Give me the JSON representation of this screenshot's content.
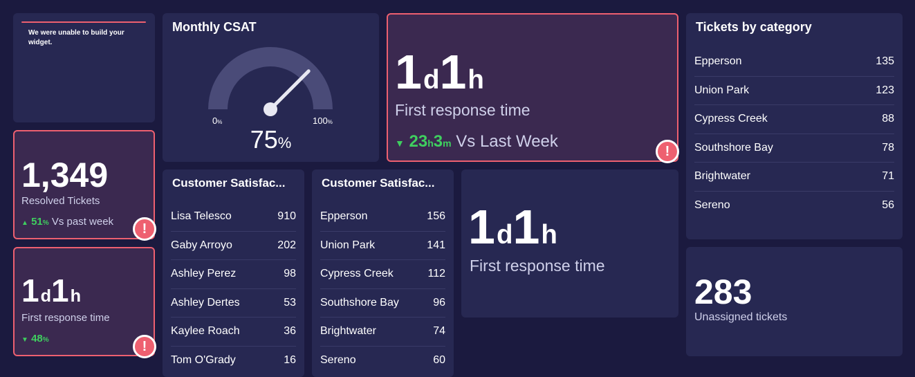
{
  "error_widget": {
    "message": "We were unable to build your widget."
  },
  "resolved": {
    "value": "1,349",
    "label": "Resolved Tickets",
    "trend_arrow": "▲",
    "trend_value": "51",
    "trend_unit": "%",
    "trend_text": "Vs past week"
  },
  "frt_small": {
    "value_d": "1",
    "unit_d": "d",
    "value_h": "1",
    "unit_h": "h",
    "label": "First response time",
    "trend_arrow": "▼",
    "trend_value": "48",
    "trend_unit": "%"
  },
  "csat": {
    "title": "Monthly CSAT",
    "min_label": "0",
    "min_unit": "%",
    "max_label": "100",
    "max_unit": "%",
    "value": "75",
    "value_unit": "%",
    "gauge_level": 0.75
  },
  "frt_large": {
    "value_d": "1",
    "unit_d": "d",
    "value_h": "1",
    "unit_h": "h",
    "label": "First response time",
    "trend_arrow": "▼",
    "trend_h": "23",
    "trend_h_unit": "h",
    "trend_m": "3",
    "trend_m_unit": "m",
    "trend_text": "Vs Last Week"
  },
  "frt_mid": {
    "value_d": "1",
    "unit_d": "d",
    "value_h": "1",
    "unit_h": "h",
    "label": "First response time"
  },
  "csat_agents": {
    "title": "Customer Satisfac...",
    "rows": [
      {
        "name": "Lisa Telesco",
        "value": "910"
      },
      {
        "name": "Gaby Arroyo",
        "value": "202"
      },
      {
        "name": "Ashley Perez",
        "value": "98"
      },
      {
        "name": "Ashley Dertes",
        "value": "53"
      },
      {
        "name": "Kaylee Roach",
        "value": "36"
      },
      {
        "name": "Tom O'Grady",
        "value": "16"
      }
    ]
  },
  "csat_locations": {
    "title": "Customer Satisfac...",
    "rows": [
      {
        "name": "Epperson",
        "value": "156"
      },
      {
        "name": "Union Park",
        "value": "141"
      },
      {
        "name": "Cypress Creek",
        "value": "112"
      },
      {
        "name": "Southshore Bay",
        "value": "96"
      },
      {
        "name": "Brightwater",
        "value": "74"
      },
      {
        "name": "Sereno",
        "value": "60"
      }
    ]
  },
  "tickets_by_category": {
    "title": "Tickets by category",
    "rows": [
      {
        "name": "Epperson",
        "value": "135"
      },
      {
        "name": "Union Park",
        "value": "123"
      },
      {
        "name": "Cypress Creek",
        "value": "88"
      },
      {
        "name": "Southshore Bay",
        "value": "78"
      },
      {
        "name": "Brightwater",
        "value": "71"
      },
      {
        "name": "Sereno",
        "value": "56"
      }
    ]
  },
  "unassigned": {
    "value": "283",
    "label": "Unassigned tickets"
  },
  "alert_icon": "!",
  "colors": {
    "background": "#1b1a3f",
    "card": "#272852",
    "alert_card": "#3b2950",
    "alert_border": "#ee6070",
    "positive": "#3fcf5f"
  }
}
